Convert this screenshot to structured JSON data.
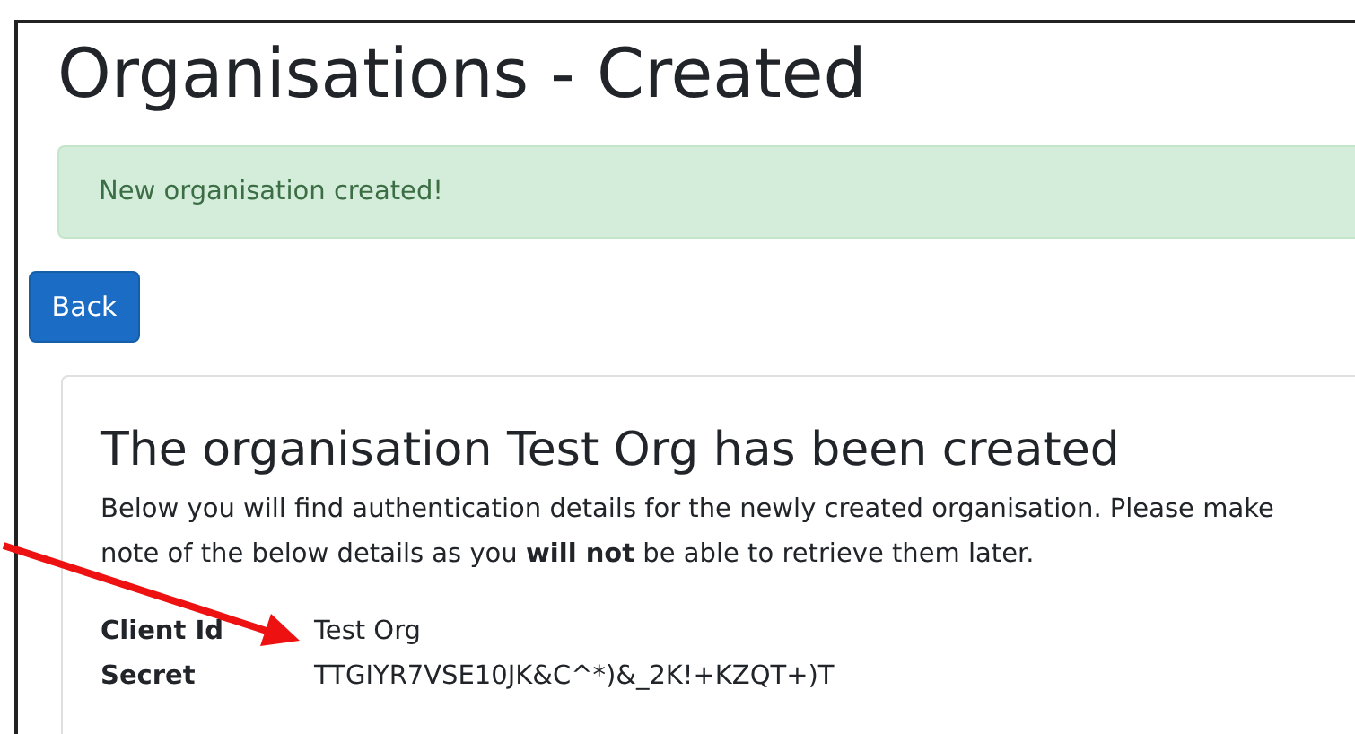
{
  "page_title": "Organisations - Created",
  "alert": {
    "text": "New organisation created!"
  },
  "back_button": "Back",
  "card": {
    "heading": "The organisation Test Org has been created",
    "paragraph": "Below you will find authentication details for the newly created organisation. Please make note of the below details as you **will not** be able to retrieve them later.",
    "details": [
      {
        "label": "Client Id",
        "value": "Test Org"
      },
      {
        "label": "Secret",
        "value": "TTGIYR7VSE10JK&C^*)&_2K!+KZQT+)T"
      }
    ]
  }
}
